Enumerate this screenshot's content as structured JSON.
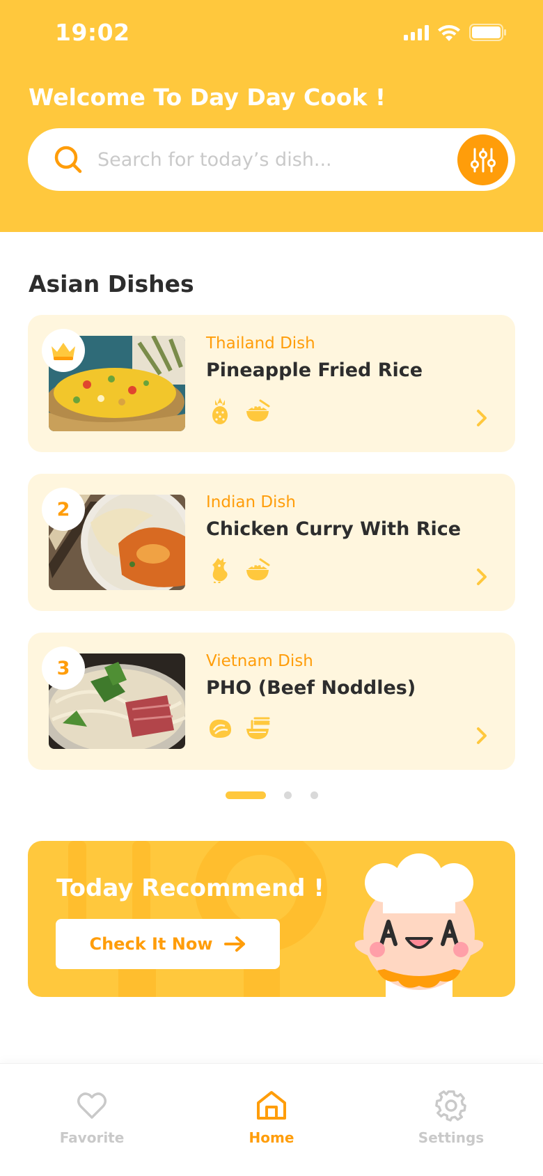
{
  "status": {
    "time": "19:02"
  },
  "header": {
    "welcome": "Welcome To Day Day Cook !",
    "search_placeholder": "Search for today’s dish..."
  },
  "section": {
    "title": "Asian Dishes"
  },
  "dishes": [
    {
      "rank": "",
      "rank_icon": "crown-icon",
      "category": "Thailand Dish",
      "name": "Pineapple Fried Rice",
      "tags": [
        "pineapple-icon",
        "rice-bowl-icon"
      ]
    },
    {
      "rank": "2",
      "category": "Indian Dish",
      "name": "Chicken Curry With Rice",
      "tags": [
        "chicken-icon",
        "rice-bowl-icon"
      ]
    },
    {
      "rank": "3",
      "category": "Vietnam Dish",
      "name": "PHO (Beef Noddles)",
      "tags": [
        "beef-icon",
        "noodle-bowl-icon"
      ]
    }
  ],
  "pager": {
    "pages": 3,
    "active": 1
  },
  "banner": {
    "title": "Today Recommend !",
    "button": "Check It Now"
  },
  "tabbar": {
    "items": [
      {
        "label": "Favorite",
        "icon": "heart-icon",
        "active": false
      },
      {
        "label": "Home",
        "icon": "home-icon",
        "active": true
      },
      {
        "label": "Settings",
        "icon": "gear-icon",
        "active": false
      }
    ]
  },
  "colors": {
    "primary": "#FFC83D",
    "accent": "#FF9D0A",
    "card_bg": "#FFF6DE",
    "inactive": "#C9C9C9"
  }
}
